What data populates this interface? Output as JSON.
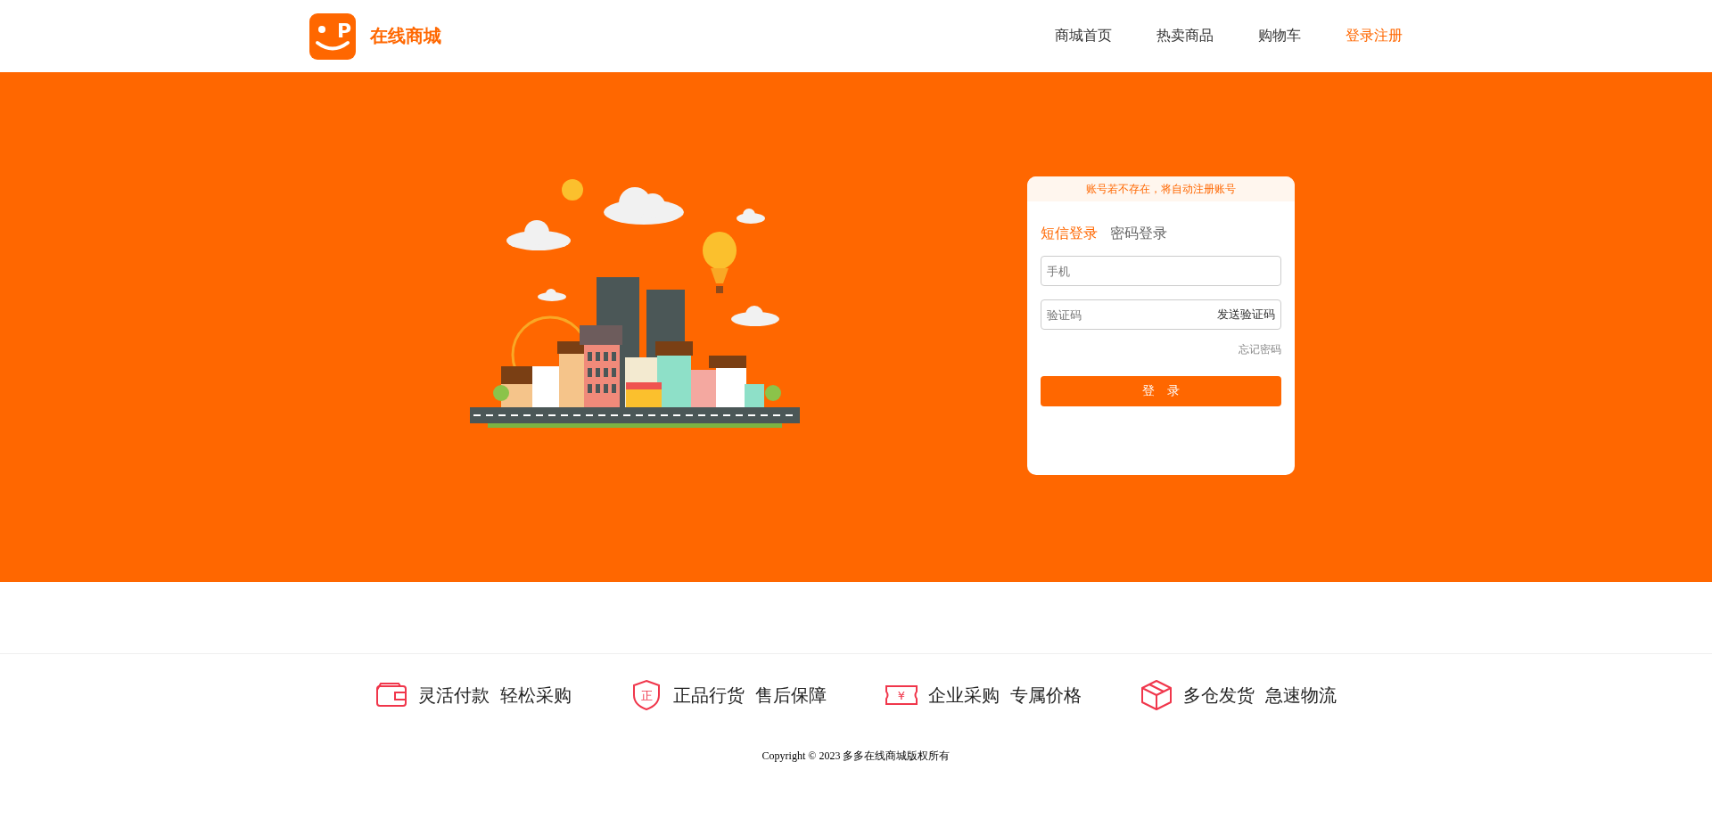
{
  "header": {
    "logo_letter": "P",
    "brand": "在线商城",
    "nav": [
      {
        "label": "商城首页",
        "selected": false
      },
      {
        "label": "热卖商品",
        "selected": false
      },
      {
        "label": "购物车",
        "selected": false
      },
      {
        "label": "登录注册",
        "selected": true
      }
    ]
  },
  "login": {
    "notice": "账号若不存在，将自动注册账号",
    "tabs": [
      {
        "label": "短信登录",
        "selected": true
      },
      {
        "label": "密码登录",
        "selected": false
      }
    ],
    "phone": {
      "placeholder": "手机"
    },
    "code": {
      "placeholder": "验证码"
    },
    "send_code": "发送验证码",
    "forgot": "忘记密码",
    "submit": "登　录"
  },
  "features": [
    {
      "kind": "wallet",
      "texts": [
        "灵活付款",
        "轻松采购"
      ]
    },
    {
      "kind": "shield",
      "icon_text": "正",
      "texts": [
        "正品行货",
        "售后保障"
      ]
    },
    {
      "kind": "ticket",
      "icon_text": "¥",
      "texts": [
        "企业采购",
        "专属价格"
      ]
    },
    {
      "kind": "box",
      "texts": [
        "多仓发货",
        "急速物流"
      ]
    }
  ],
  "copyright": "Copyright © 2023 多多在线商城版权所有"
}
